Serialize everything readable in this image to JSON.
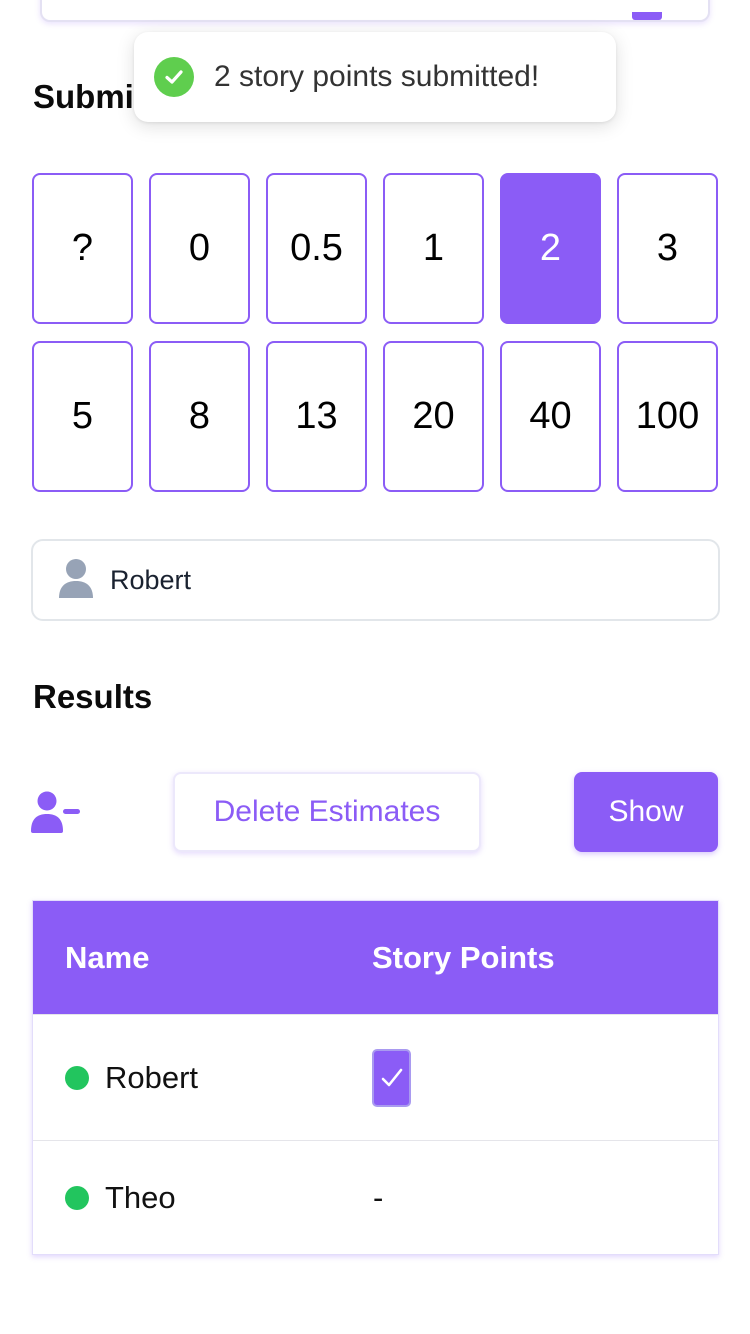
{
  "submit_section": {
    "title": "Submit"
  },
  "toast": {
    "message": "2 story points submitted!",
    "icon": "check-circle-icon",
    "color": "#5fce4e"
  },
  "cards": [
    {
      "label": "?",
      "selected": false
    },
    {
      "label": "0",
      "selected": false
    },
    {
      "label": "0.5",
      "selected": false
    },
    {
      "label": "1",
      "selected": false
    },
    {
      "label": "2",
      "selected": true
    },
    {
      "label": "3",
      "selected": false
    },
    {
      "label": "5",
      "selected": false
    },
    {
      "label": "8",
      "selected": false
    },
    {
      "label": "13",
      "selected": false
    },
    {
      "label": "20",
      "selected": false
    },
    {
      "label": "40",
      "selected": false
    },
    {
      "label": "100",
      "selected": false
    }
  ],
  "name_field": {
    "value": "Robert",
    "icon": "user-icon"
  },
  "results": {
    "title": "Results",
    "remove_icon": "user-minus-icon",
    "delete_label": "Delete Estimates",
    "show_label": "Show",
    "columns": {
      "name": "Name",
      "points": "Story Points"
    },
    "rows": [
      {
        "name": "Robert",
        "status": "online",
        "points": "submitted"
      },
      {
        "name": "Theo",
        "status": "online",
        "points": "-"
      }
    ]
  },
  "colors": {
    "accent": "#8b5cf6",
    "online": "#22c55e",
    "icon_gray": "#97a3b6"
  }
}
